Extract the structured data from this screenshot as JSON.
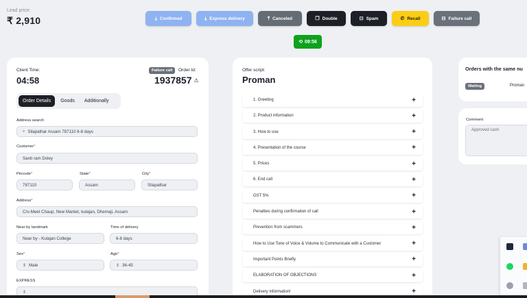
{
  "lead": {
    "label": "Lead price:",
    "price": "₹ 2,910"
  },
  "actions": [
    {
      "label": "Confirmed",
      "icon": "download-icon",
      "color": "#8fb2f1"
    },
    {
      "label": "Express delivery",
      "icon": "download-icon",
      "color": "#8fb2f1"
    },
    {
      "label": "Canceled",
      "icon": "upload-icon",
      "color": "#666c74"
    },
    {
      "label": "Double",
      "icon": "copy-icon",
      "color": "#1d2026"
    },
    {
      "label": "Spam",
      "icon": "spam-icon",
      "color": "#1d2026"
    },
    {
      "label": "Recall",
      "icon": "phone-icon",
      "color": "#fbcd16"
    },
    {
      "label": "Failure call",
      "icon": "minus-square-icon",
      "color": "#6b7179"
    }
  ],
  "timer": {
    "value": "09:56",
    "color": "#0ea21d"
  },
  "client": {
    "time_label": "Client Time:",
    "time": "04:58",
    "status_badge": "Failure call",
    "order_label": "Order Id:",
    "order_id": "1937857"
  },
  "tabs": [
    "Order Details",
    "Goods",
    "Additionally"
  ],
  "form": {
    "address_search": {
      "label": "Address search",
      "value": "Silapathar Assam 787110 6-8 days"
    },
    "customer": {
      "label": "Customer",
      "value": "Santi ram Doley"
    },
    "pincode": {
      "label": "Pincode",
      "value": "787110"
    },
    "state": {
      "label": "State",
      "value": "Assam"
    },
    "city": {
      "label": "City",
      "value": "Silapathar"
    },
    "address": {
      "label": "Address",
      "value": "C/o-Meet Chaup, New Market, kulajan, Dhemaji, Assam"
    },
    "landmark": {
      "label": "Near by landmark",
      "value": "Near by - Kulajan College"
    },
    "delivery_time": {
      "label": "Time of delivery",
      "value": "6-8 days"
    },
    "sex": {
      "label": "Sex",
      "value": "Male"
    },
    "age": {
      "label": "Age",
      "value": "36-45"
    },
    "express": {
      "label": "EXPRESS"
    }
  },
  "offer": {
    "label": "Offer script:",
    "product": "Proman",
    "items": [
      "1. Greeting",
      "2. Product information",
      "3. How to use",
      "4. Presentation of the course",
      "5. Prices",
      "6. End call",
      "GST 5%",
      "Penalties during confirmation of call",
      "Prevention from scammers",
      "How to Use Tone of Voice & Volume to Communicate with a Customer",
      "Important Points Briefly",
      "ELABORATION OF OBJECTIONS",
      "Delivery information!"
    ]
  },
  "same_number": {
    "title": "Orders with the same nu",
    "status": "Waiting",
    "product": "Proman"
  },
  "comment": {
    "label": "Comment",
    "value": "Approved cash"
  }
}
